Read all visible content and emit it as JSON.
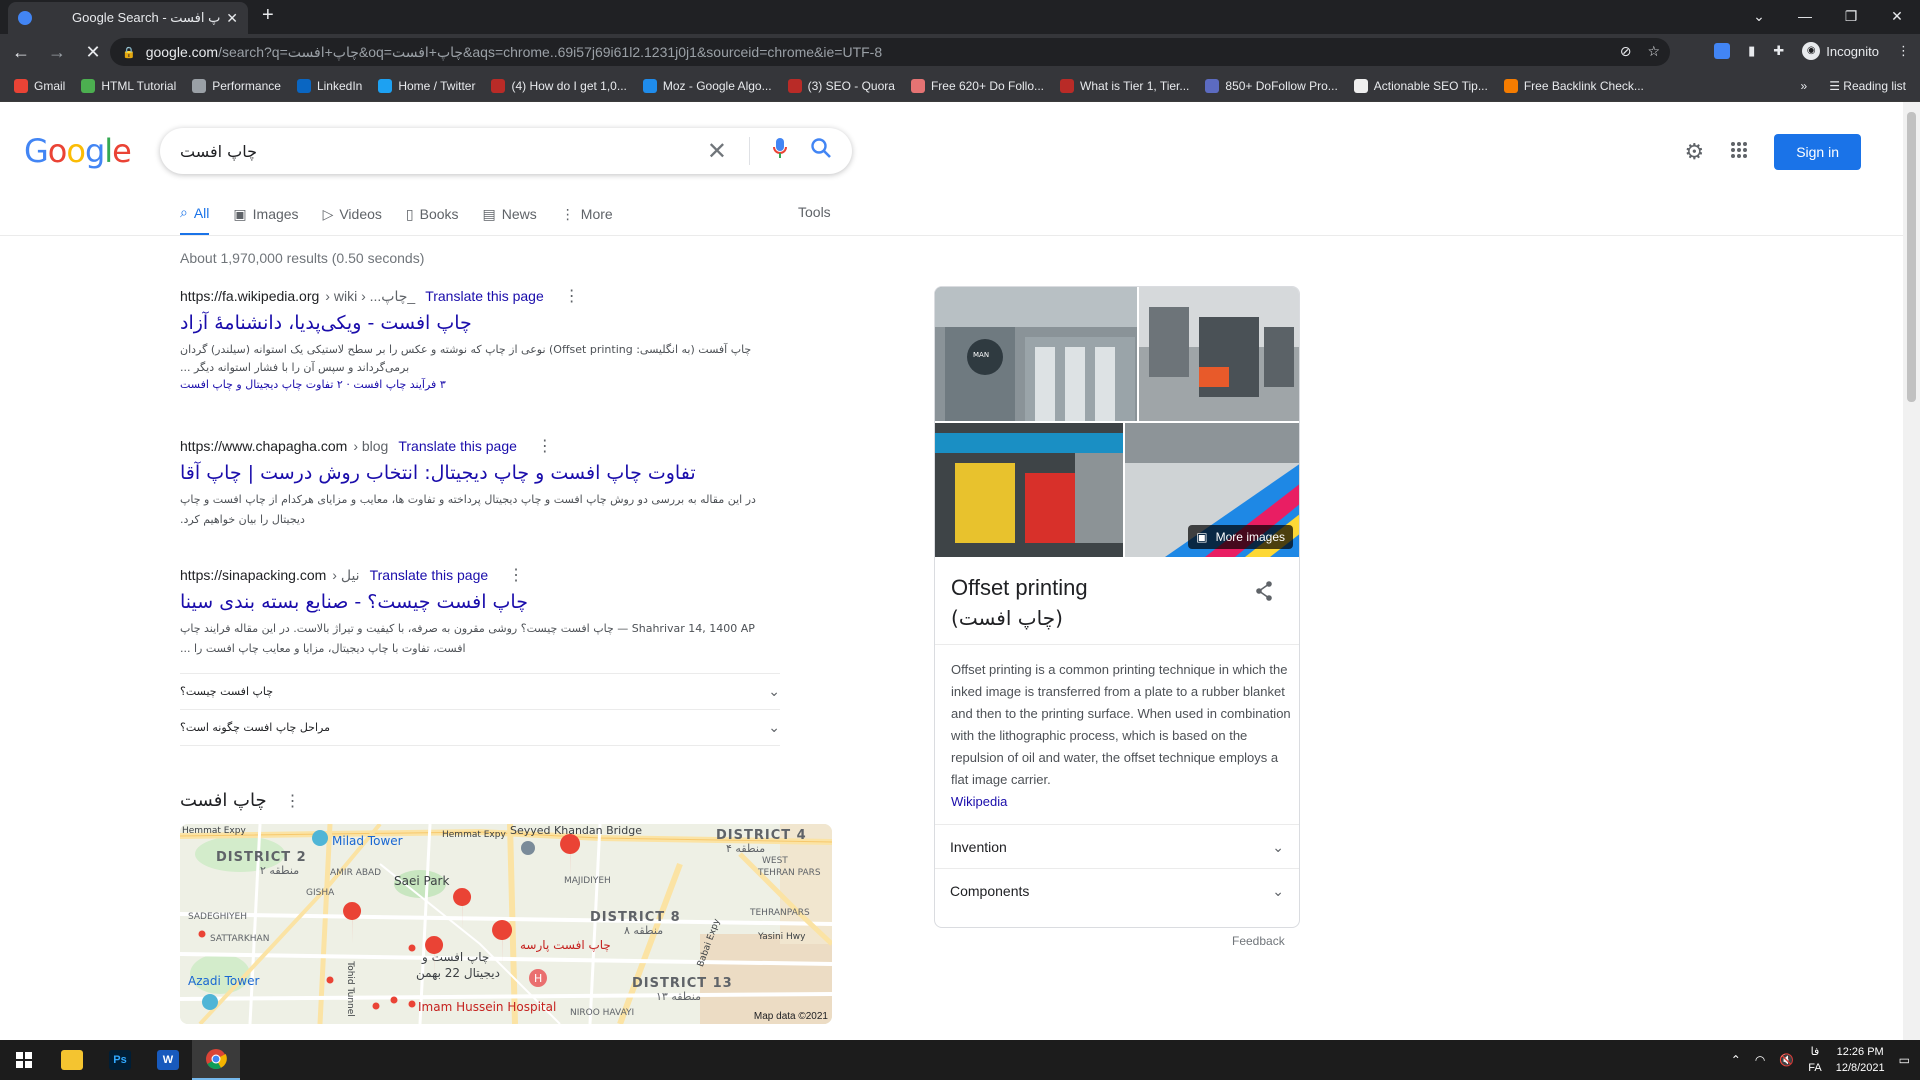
{
  "browser": {
    "tab_title": "Google Search - چاپ افست",
    "tab_close": "✕",
    "new_tab": "+",
    "url_host": "google.com",
    "url_path": "/search?q=چاپ+افست&oq=چاپ+افست&aqs=chrome..69i57j69i61l2.1231j0j1&sourceid=chrome&ie=UTF-8",
    "incognito_label": "Incognito",
    "bookmarks": [
      {
        "label": "Gmail",
        "icon": "gmail-icon",
        "color": "#ea4335"
      },
      {
        "label": "HTML Tutorial",
        "icon": "w3-icon",
        "color": "#4caf50"
      },
      {
        "label": "Performance",
        "icon": "performance-icon",
        "color": "#9aa0a6"
      },
      {
        "label": "LinkedIn",
        "icon": "linkedin-icon",
        "color": "#0a66c2"
      },
      {
        "label": "Home / Twitter",
        "icon": "twitter-icon",
        "color": "#1da1f2"
      },
      {
        "label": "(4) How do I get 1,0...",
        "icon": "quora-icon",
        "color": "#b92b27"
      },
      {
        "label": "Moz - Google Algo...",
        "icon": "moz-icon",
        "color": "#1f8ceb"
      },
      {
        "label": "(3) SEO - Quora",
        "icon": "quora-icon",
        "color": "#b92b27"
      },
      {
        "label": "Free 620+ Do Follo...",
        "icon": "globe-icon",
        "color": "#e57373"
      },
      {
        "label": "What is Tier 1, Tier...",
        "icon": "quora-icon",
        "color": "#b92b27"
      },
      {
        "label": "850+ DoFollow Pro...",
        "icon": "page-icon",
        "color": "#5c6bc0"
      },
      {
        "label": "Actionable SEO Tip...",
        "icon": "seo-icon",
        "color": "#eeeeee"
      },
      {
        "label": "Free Backlink Check...",
        "icon": "ahrefs-icon",
        "color": "#f57c00"
      }
    ],
    "bookmarks_more": "»",
    "reading_list": "Reading list"
  },
  "google": {
    "logo": "Google",
    "query": "چاپ افست",
    "signin": "Sign in",
    "tabs": [
      {
        "label": "All",
        "icon": "search-icon",
        "active": true
      },
      {
        "label": "Images",
        "icon": "image-icon"
      },
      {
        "label": "Videos",
        "icon": "video-icon"
      },
      {
        "label": "Books",
        "icon": "book-icon"
      },
      {
        "label": "News",
        "icon": "news-icon"
      },
      {
        "label": "More",
        "icon": "more-vert-icon"
      }
    ],
    "tools": "Tools",
    "stats": "About 1,970,000 results (0.50 seconds)",
    "results": [
      {
        "url": "https://fa.wikipedia.org",
        "crumb": "› wiki › ...چاپ_",
        "translate": "Translate this page",
        "title": "چاپ افست - ویکی‌پدیا، دانشنامهٔ آزاد",
        "snippet1": "چاپ آفست (به انگلیسی: Offset printing) نوعی از چاپ که نوشته و عکس را بر سطح لاستیکی یک استوانه (سیلندر) گردان",
        "snippet2": "برمی‌گرداند و سپس آن را با فشار استوانه دیگر ...",
        "links": "۳ فرآیند چاپ افست · ۲ تفاوت چاپ دیجیتال و چاپ افست"
      },
      {
        "url": "https://www.chapagha.com",
        "crumb": "› blog",
        "translate": "Translate this page",
        "title": "تفاوت چاپ افست و چاپ دیجیتال: انتخاب روش درست | چاپ آقا",
        "snippet1": "در این مقاله به بررسی دو روش چاپ افست و چاپ دیجیتال پرداخته و تفاوت ها، معایب و مزایای هرکدام از چاپ افست و چاپ",
        "snippet2": "دیجیتال را بیان خواهیم کرد."
      },
      {
        "url": "https://sinapacking.com",
        "crumb": "› نیل",
        "translate": "Translate this page",
        "title": "چاپ افست چیست؟ - صنایع بسته بندی سینا",
        "snippet1": "Shahrivar 14, 1400 AP — چاپ افست چیست؟ روشی مقرون به صرفه، با کیفیت و تیراژ بالاست. در این مقاله فرایند چاپ",
        "snippet2": "افست، تفاوت با چاپ دیجیتال، مزایا و معایب چاپ افست را ..."
      }
    ],
    "paa": [
      "چاپ افست چیست؟",
      "مراحل چاپ افست چگونه است؟"
    ],
    "local_title": "چاپ افست",
    "map": {
      "labels": {
        "hemmat1": "Hemmat Expy",
        "milad": "Milad Tower",
        "hemmat2": "Hemmat Expy",
        "seyyed": "Seyyed Khandan Bridge",
        "d4": "DISTRICT 4",
        "d4fa": "منطقه ۴",
        "d2": "DISTRICT 2",
        "d2fa": "منطقه ۲",
        "amirabad": "AMIR ABAD",
        "gisha": "GISHA",
        "saei": "Saei Park",
        "majidiyeh": "MAJIDIYEH",
        "west": "WEST",
        "tehranpars1": "TEHRAN PARS",
        "sadeghiyeh": "SADEGHIYEH",
        "sattarkhan": "SATTARKHAN",
        "d8": "DISTRICT 8",
        "d8fa": "منطقه ۸",
        "tehranpars2": "TEHRANPARS",
        "yasini": "Yasini Hwy",
        "babai": "Babai Expy",
        "parseh": "چاپ افست پارسه",
        "bahman1": "چاپ افست و",
        "bahman2": "دیجیتال 22 بهمن",
        "azadi": "Azadi Tower",
        "tohid": "Tohid Tunnel",
        "imam": "Imam Hussein Hospital",
        "d13": "DISTRICT 13",
        "d13fa": "منطقه ۱۳",
        "niroo": "NIROO HAVAYI"
      },
      "credit": "Map data ©2021"
    },
    "knowledge": {
      "more_images": "More images",
      "title": "Offset printing",
      "title_fa": "(چاپ افست)",
      "description": "Offset printing is a common printing technique in which the inked image is transferred from a plate to a rubber blanket and then to the printing surface. When used in combination with the lithographic process, which is based on the repulsion of oil and water, the offset technique employs a flat image carrier.",
      "source": "Wikipedia",
      "rows": [
        "Invention",
        "Components"
      ],
      "feedback": "Feedback"
    }
  },
  "taskbar": {
    "clock_time": "12:26 PM",
    "clock_date": "12/8/2021",
    "lang_top": "فا",
    "lang_bottom": "FA"
  }
}
